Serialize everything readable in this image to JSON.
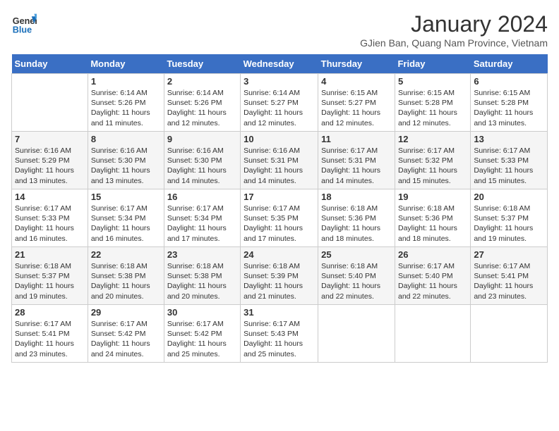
{
  "header": {
    "logo_line1": "General",
    "logo_line2": "Blue",
    "month": "January 2024",
    "location": "GJien Ban, Quang Nam Province, Vietnam"
  },
  "days_of_week": [
    "Sunday",
    "Monday",
    "Tuesday",
    "Wednesday",
    "Thursday",
    "Friday",
    "Saturday"
  ],
  "weeks": [
    [
      {
        "num": "",
        "info": ""
      },
      {
        "num": "1",
        "info": "Sunrise: 6:14 AM\nSunset: 5:26 PM\nDaylight: 11 hours\nand 11 minutes."
      },
      {
        "num": "2",
        "info": "Sunrise: 6:14 AM\nSunset: 5:26 PM\nDaylight: 11 hours\nand 12 minutes."
      },
      {
        "num": "3",
        "info": "Sunrise: 6:14 AM\nSunset: 5:27 PM\nDaylight: 11 hours\nand 12 minutes."
      },
      {
        "num": "4",
        "info": "Sunrise: 6:15 AM\nSunset: 5:27 PM\nDaylight: 11 hours\nand 12 minutes."
      },
      {
        "num": "5",
        "info": "Sunrise: 6:15 AM\nSunset: 5:28 PM\nDaylight: 11 hours\nand 12 minutes."
      },
      {
        "num": "6",
        "info": "Sunrise: 6:15 AM\nSunset: 5:28 PM\nDaylight: 11 hours\nand 13 minutes."
      }
    ],
    [
      {
        "num": "7",
        "info": "Sunrise: 6:16 AM\nSunset: 5:29 PM\nDaylight: 11 hours\nand 13 minutes."
      },
      {
        "num": "8",
        "info": "Sunrise: 6:16 AM\nSunset: 5:30 PM\nDaylight: 11 hours\nand 13 minutes."
      },
      {
        "num": "9",
        "info": "Sunrise: 6:16 AM\nSunset: 5:30 PM\nDaylight: 11 hours\nand 14 minutes."
      },
      {
        "num": "10",
        "info": "Sunrise: 6:16 AM\nSunset: 5:31 PM\nDaylight: 11 hours\nand 14 minutes."
      },
      {
        "num": "11",
        "info": "Sunrise: 6:17 AM\nSunset: 5:31 PM\nDaylight: 11 hours\nand 14 minutes."
      },
      {
        "num": "12",
        "info": "Sunrise: 6:17 AM\nSunset: 5:32 PM\nDaylight: 11 hours\nand 15 minutes."
      },
      {
        "num": "13",
        "info": "Sunrise: 6:17 AM\nSunset: 5:33 PM\nDaylight: 11 hours\nand 15 minutes."
      }
    ],
    [
      {
        "num": "14",
        "info": "Sunrise: 6:17 AM\nSunset: 5:33 PM\nDaylight: 11 hours\nand 16 minutes."
      },
      {
        "num": "15",
        "info": "Sunrise: 6:17 AM\nSunset: 5:34 PM\nDaylight: 11 hours\nand 16 minutes."
      },
      {
        "num": "16",
        "info": "Sunrise: 6:17 AM\nSunset: 5:34 PM\nDaylight: 11 hours\nand 17 minutes."
      },
      {
        "num": "17",
        "info": "Sunrise: 6:17 AM\nSunset: 5:35 PM\nDaylight: 11 hours\nand 17 minutes."
      },
      {
        "num": "18",
        "info": "Sunrise: 6:18 AM\nSunset: 5:36 PM\nDaylight: 11 hours\nand 18 minutes."
      },
      {
        "num": "19",
        "info": "Sunrise: 6:18 AM\nSunset: 5:36 PM\nDaylight: 11 hours\nand 18 minutes."
      },
      {
        "num": "20",
        "info": "Sunrise: 6:18 AM\nSunset: 5:37 PM\nDaylight: 11 hours\nand 19 minutes."
      }
    ],
    [
      {
        "num": "21",
        "info": "Sunrise: 6:18 AM\nSunset: 5:37 PM\nDaylight: 11 hours\nand 19 minutes."
      },
      {
        "num": "22",
        "info": "Sunrise: 6:18 AM\nSunset: 5:38 PM\nDaylight: 11 hours\nand 20 minutes."
      },
      {
        "num": "23",
        "info": "Sunrise: 6:18 AM\nSunset: 5:38 PM\nDaylight: 11 hours\nand 20 minutes."
      },
      {
        "num": "24",
        "info": "Sunrise: 6:18 AM\nSunset: 5:39 PM\nDaylight: 11 hours\nand 21 minutes."
      },
      {
        "num": "25",
        "info": "Sunrise: 6:18 AM\nSunset: 5:40 PM\nDaylight: 11 hours\nand 22 minutes."
      },
      {
        "num": "26",
        "info": "Sunrise: 6:17 AM\nSunset: 5:40 PM\nDaylight: 11 hours\nand 22 minutes."
      },
      {
        "num": "27",
        "info": "Sunrise: 6:17 AM\nSunset: 5:41 PM\nDaylight: 11 hours\nand 23 minutes."
      }
    ],
    [
      {
        "num": "28",
        "info": "Sunrise: 6:17 AM\nSunset: 5:41 PM\nDaylight: 11 hours\nand 23 minutes."
      },
      {
        "num": "29",
        "info": "Sunrise: 6:17 AM\nSunset: 5:42 PM\nDaylight: 11 hours\nand 24 minutes."
      },
      {
        "num": "30",
        "info": "Sunrise: 6:17 AM\nSunset: 5:42 PM\nDaylight: 11 hours\nand 25 minutes."
      },
      {
        "num": "31",
        "info": "Sunrise: 6:17 AM\nSunset: 5:43 PM\nDaylight: 11 hours\nand 25 minutes."
      },
      {
        "num": "",
        "info": ""
      },
      {
        "num": "",
        "info": ""
      },
      {
        "num": "",
        "info": ""
      }
    ]
  ]
}
